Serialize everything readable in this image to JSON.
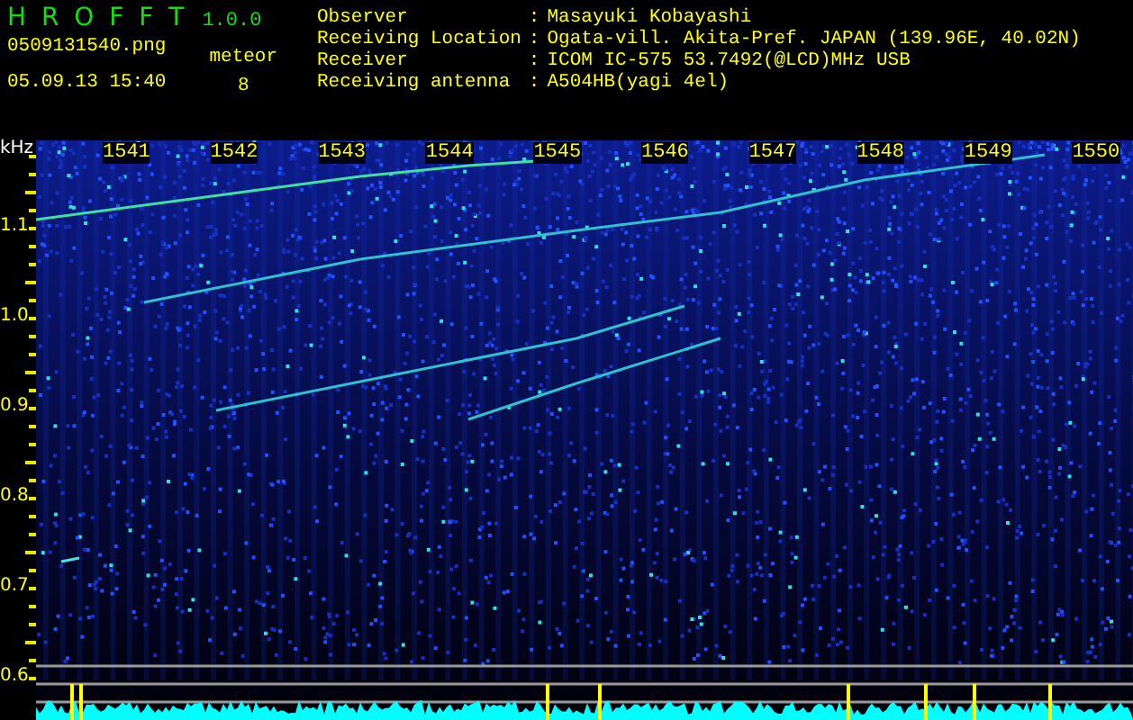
{
  "app": {
    "title": "H R O F F T",
    "version": "1.0.0"
  },
  "file": "0509131540.png",
  "timestamp": "05.09.13 15:40",
  "meteor": {
    "label": "meteor",
    "count": "8"
  },
  "info": [
    {
      "label": "Observer",
      "separator": ":",
      "value": "Masayuki Kobayashi"
    },
    {
      "label": "Receiving Location",
      "separator": ":",
      "value": "Ogata-vill. Akita-Pref. JAPAN (139.96E, 40.02N)"
    },
    {
      "label": "Receiver",
      "separator": ":",
      "value": "ICOM IC-575 53.7492(@LCD)MHz USB"
    },
    {
      "label": "Receiving antenna",
      "separator": ":",
      "value": "A504HB(yagi 4el)"
    }
  ],
  "axis": {
    "unit": "kHz",
    "y_ticks": [
      "1.1",
      "1.0",
      "0.9",
      "0.8",
      "0.7",
      "0.6"
    ],
    "time_ticks": [
      "1541",
      "1542",
      "1543",
      "1544",
      "1545",
      "1546",
      "1547",
      "1548",
      "1549",
      "1550"
    ]
  }
}
